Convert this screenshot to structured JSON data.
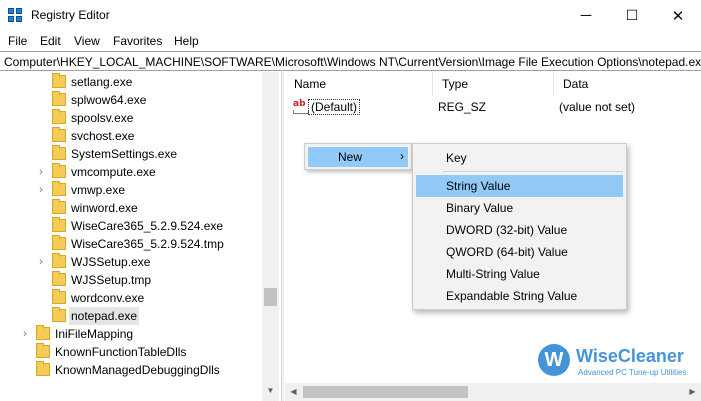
{
  "window": {
    "title": "Registry Editor",
    "controls": {
      "minimize": "─",
      "maximize": "☐",
      "close": "✕"
    }
  },
  "menu": [
    "File",
    "Edit",
    "View",
    "Favorites",
    "Help"
  ],
  "address": "Computer\\HKEY_LOCAL_MACHINE\\SOFTWARE\\Microsoft\\Windows NT\\CurrentVersion\\Image File Execution Options\\notepad.exe",
  "tree": {
    "items": [
      {
        "label": "setlang.exe",
        "expandable": false,
        "level": 2
      },
      {
        "label": "splwow64.exe",
        "expandable": false,
        "level": 2
      },
      {
        "label": "spoolsv.exe",
        "expandable": false,
        "level": 2
      },
      {
        "label": "svchost.exe",
        "expandable": false,
        "level": 2
      },
      {
        "label": "SystemSettings.exe",
        "expandable": false,
        "level": 2
      },
      {
        "label": "vmcompute.exe",
        "expandable": true,
        "level": 2
      },
      {
        "label": "vmwp.exe",
        "expandable": true,
        "level": 2
      },
      {
        "label": "winword.exe",
        "expandable": false,
        "level": 2
      },
      {
        "label": "WiseCare365_5.2.9.524.exe",
        "expandable": false,
        "level": 2
      },
      {
        "label": "WiseCare365_5.2.9.524.tmp",
        "expandable": false,
        "level": 2
      },
      {
        "label": "WJSSetup.exe",
        "expandable": true,
        "level": 2
      },
      {
        "label": "WJSSetup.tmp",
        "expandable": false,
        "level": 2
      },
      {
        "label": "wordconv.exe",
        "expandable": false,
        "level": 2
      },
      {
        "label": "notepad.exe",
        "expandable": false,
        "level": 2,
        "selected": true
      },
      {
        "label": "IniFileMapping",
        "expandable": true,
        "level": 1
      },
      {
        "label": "KnownFunctionTableDlls",
        "expandable": false,
        "level": 1
      },
      {
        "label": "KnownManagedDebuggingDlls",
        "expandable": false,
        "level": 1
      }
    ]
  },
  "list": {
    "columns": [
      "Name",
      "Type",
      "Data"
    ],
    "rows": [
      {
        "name": "(Default)",
        "type": "REG_SZ",
        "data": "(value not set)",
        "icon": "string-value-icon"
      }
    ]
  },
  "context_menu": {
    "item": "New",
    "arrow": "›",
    "submenu": [
      "Key",
      "String Value",
      "Binary Value",
      "DWORD (32-bit) Value",
      "QWORD (64-bit) Value",
      "Multi-String Value",
      "Expandable String Value"
    ],
    "highlighted": "String Value"
  },
  "watermark": {
    "letter": "W",
    "brand": "WiseCleaner",
    "tagline": "Advanced PC Tune-up Utilities"
  },
  "colors": {
    "highlight": "#91c9f7",
    "folder": "#f4cc55",
    "brand": "#3c8fd6"
  }
}
